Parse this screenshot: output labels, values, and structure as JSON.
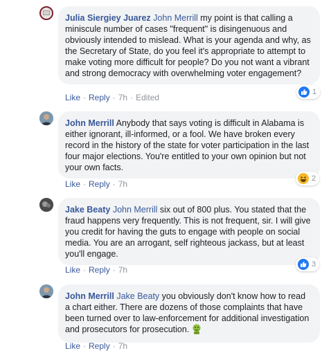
{
  "colors": {
    "link": "#385898",
    "bubble": "#f2f3f5",
    "muted": "#90949c",
    "like_blue": "#2078f4",
    "haha_yellow": "#f7b928"
  },
  "comments": [
    {
      "author": "Julia Siergiey Juarez",
      "mention": "John Merrill",
      "text": " my point is that calling a miniscule number of cases \"frequent\" is disingenuous and obviously intended to mislead. What is your agenda and why, as the Secretary of State, do you feel it's appropriate to attempt to make voting more difficult for people? Do you not want a vibrant and strong democracy with overwhelming voter engagement?",
      "like": "Like",
      "reply": "Reply",
      "time": "7h",
      "edited": "Edited",
      "reaction_icon": "like-icon",
      "reaction_count": "1"
    },
    {
      "author": "John Merrill",
      "mention": "",
      "text": " Anybody that says voting is difficult in Alabama is either ignorant, ill-informed, or a fool. We have broken every record in the history of the state for voter participation in the last four major elections. You're entitled to your own opinion but not your own facts.",
      "like": "Like",
      "reply": "Reply",
      "time": "7h",
      "reaction_icon": "haha-icon",
      "reaction_count": "2"
    },
    {
      "author": "Jake Beaty",
      "mention": "John Merrill",
      "text": " six out of 800 plus. You stated that the fraud happens very frequently. This is not frequent, sir. I will give you credit for having the guts to engage with people on social media. You are an arrogant, self righteous jackass, but at least you'll engage.",
      "like": "Like",
      "reply": "Reply",
      "time": "7h",
      "reaction_icon": "like-icon",
      "reaction_count": "3"
    },
    {
      "author": "John Merrill",
      "mention": "Jake Beaty",
      "text": " you obviously don't know how to read a chart either. There are dozens of those complaints that have been turned over to law-enforcement for additional investigation and prosecutors for prosecution. ",
      "emoji_icon": "nauseated-face-icon",
      "like": "Like",
      "reply": "Reply",
      "time": "7h"
    }
  ]
}
